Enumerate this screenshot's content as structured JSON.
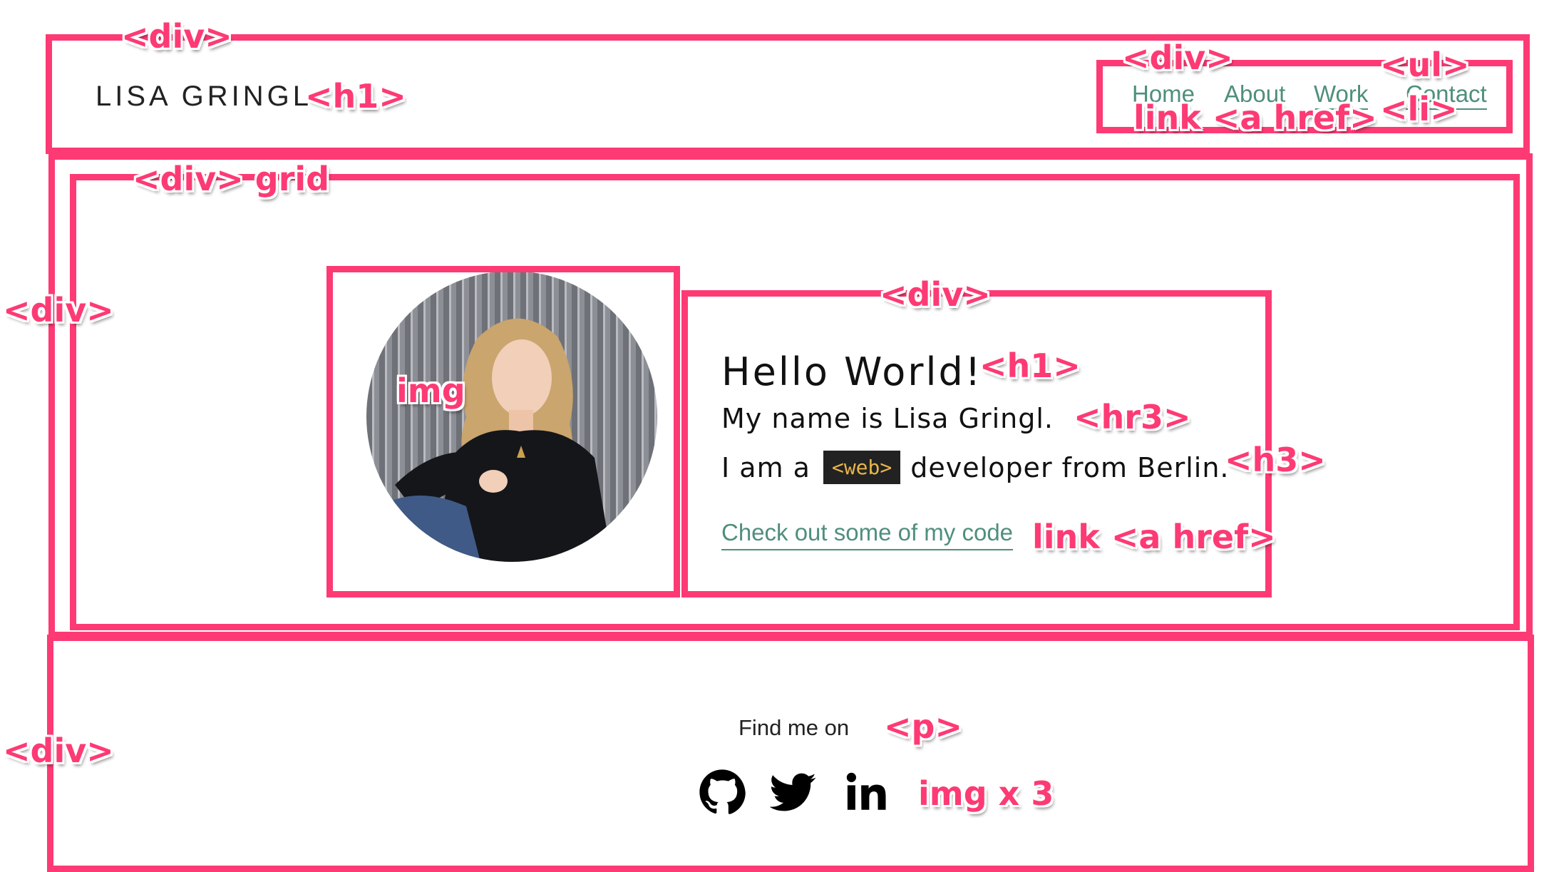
{
  "header": {
    "logo": "LISA GRINGL",
    "nav": [
      {
        "label": "Home"
      },
      {
        "label": "About"
      },
      {
        "label": "Work"
      },
      {
        "label": "Contact"
      }
    ]
  },
  "hero": {
    "title": "Hello World!",
    "line1": "My name is Lisa Gringl.",
    "line2_prefix": "I am a",
    "line2_chip": "<web>",
    "line2_suffix": "developer from Berlin.",
    "link": "Check out some of my code"
  },
  "footer": {
    "text": "Find me on",
    "icons": [
      "github-icon",
      "twitter-icon",
      "linkedin-icon"
    ]
  },
  "annotations": {
    "div_header": "<div>",
    "h1_logo": "<h1>",
    "div_nav": "<div>",
    "ul": "<ul>",
    "link_a_href_nav": "link <a href>",
    "li": "<li>",
    "div_grid": "<div> grid",
    "div_main": "<div>",
    "img": "img",
    "div_text": "<div>",
    "h1_title": "<h1>",
    "hr3": "<hr3>",
    "h3": "<h3>",
    "link_a_href_code": "link <a href>",
    "div_footer": "<div>",
    "p": "<p>",
    "img_x3": "img x 3"
  },
  "colors": {
    "annotation": "#fd3a74",
    "link": "#4f8f7c",
    "chip_bg": "#222222",
    "chip_text": "#e8b64a"
  }
}
